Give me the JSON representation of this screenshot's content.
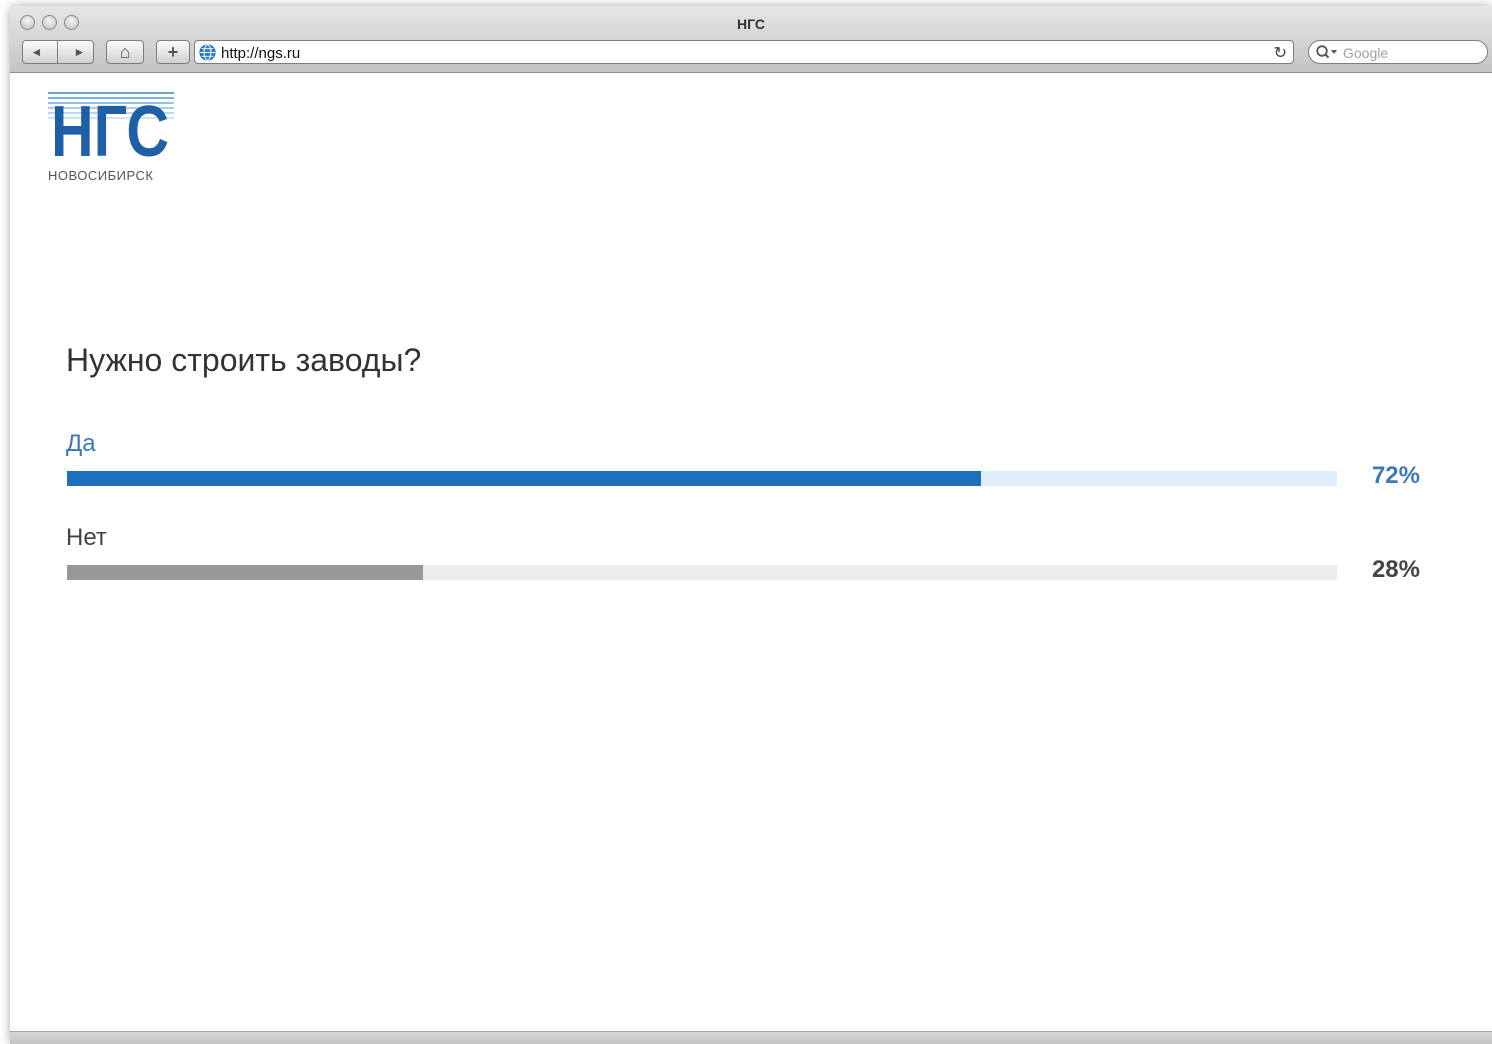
{
  "window": {
    "title": "НГС"
  },
  "toolbar": {
    "back_label": "◄",
    "forward_label": "►",
    "home_label": "⌂",
    "add_label": "+",
    "url": "http://ngs.ru",
    "reload_label": "↻",
    "search_placeholder": "Google"
  },
  "logo": {
    "wordmark": "НГС",
    "city": "НОВОСИБИРСК"
  },
  "poll": {
    "question": "Нужно строить заводы?",
    "options": [
      {
        "label": "Да",
        "percent_text": "72%",
        "fraction": 0.72,
        "color": "#1e6fbd",
        "track_color": "#deeefb",
        "label_color": "#3d79b8"
      },
      {
        "label": "Нет",
        "percent_text": "28%",
        "fraction": 0.28,
        "color": "#989898",
        "track_color": "#ececec",
        "label_color": "#444444"
      }
    ]
  }
}
